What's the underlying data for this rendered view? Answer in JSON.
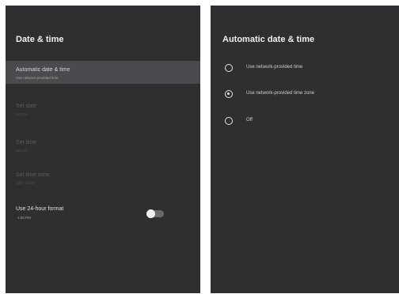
{
  "left_panel": {
    "title": "Date & time",
    "items": [
      {
        "title": "Automatic date & time",
        "subtitle": "Use network-provided time"
      },
      {
        "title": "Set date",
        "subtitle": "Not set"
      },
      {
        "title": "Set time",
        "subtitle": "Not set"
      },
      {
        "title": "Set time zone",
        "subtitle": "GMT+00:00"
      },
      {
        "title": "Use 24-hour format",
        "subtitle": "1:00 PM",
        "toggle_on": false
      }
    ]
  },
  "right_panel": {
    "title": "Automatic date & time",
    "options": [
      {
        "label": "Use network-provided time",
        "selected": false
      },
      {
        "label": "Use network-provided time zone",
        "selected": true
      },
      {
        "label": "Off",
        "selected": false
      }
    ]
  },
  "colors": {
    "panel_bg": "#2e2f31",
    "selected_bg": "#4a4b4e",
    "text": "#f1f1f1"
  }
}
